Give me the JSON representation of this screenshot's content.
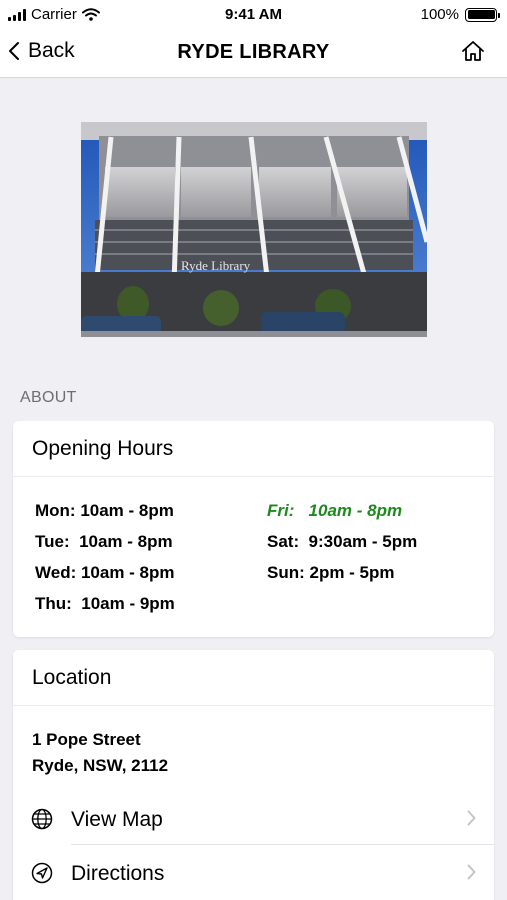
{
  "status_bar": {
    "carrier": "Carrier",
    "time": "9:41 AM",
    "battery": "100%",
    "battery_level": 1.0
  },
  "nav": {
    "back_label": "Back",
    "title": "RYDE LIBRARY",
    "back_icon": "chevron-left-icon",
    "home_icon": "home-icon"
  },
  "photo": {
    "sign_text": "Ryde Library"
  },
  "about": {
    "section_label": "ABOUT"
  },
  "hours": {
    "title": "Opening Hours",
    "left": [
      "Mon: 10am - 8pm",
      "Tue:  10am - 8pm",
      "Wed: 10am - 8pm",
      "Thu:  10am - 9pm"
    ],
    "right": [
      "Fri:   10am - 8pm",
      "Sat:  9:30am - 5pm",
      "Sun: 2pm - 5pm"
    ],
    "today_color": "#1e8a1e"
  },
  "location": {
    "title": "Location",
    "address_line1": "1 Pope Street",
    "address_line2": "Ryde, NSW, 2112",
    "view_map_label": "View Map",
    "directions_label": "Directions",
    "view_map_icon": "globe-icon",
    "directions_icon": "navigation-arrow-icon"
  }
}
